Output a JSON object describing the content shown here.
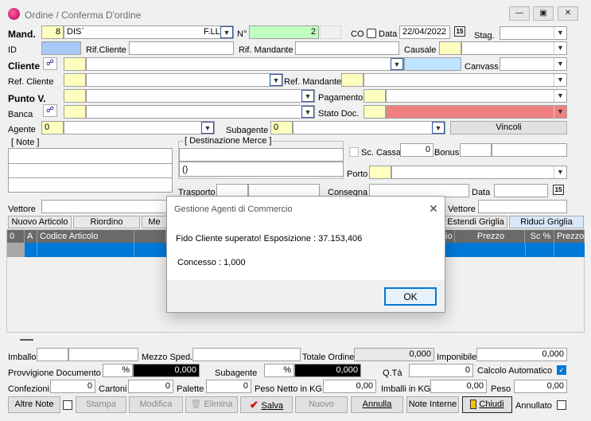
{
  "window": {
    "title": "Ordine / Conferma D'ordine"
  },
  "header": {
    "mand_label": "Mand.",
    "mand_code": "8",
    "mand_name": "DIS`",
    "mand_fl": "F.LL",
    "n_label": "N°",
    "n_value": "2",
    "co_label": "CO",
    "data_label": "Data",
    "data_value": "22/04/2022",
    "cal_label": "15",
    "stag_label": "Stag.",
    "id_label": "ID",
    "rif_cliente_label": "Rif.Cliente",
    "rif_mandante_label": "Rif. Mandante",
    "causale_label": "Causale",
    "cliente_label": "Cliente",
    "canvass_label": "Canvass",
    "ref_cliente_label": "Ref. Cliente",
    "ref_mandante_label": "Ref. Mandante",
    "punto_v_label": "Punto V.",
    "pagamento_label": "Pagamento",
    "banca_label": "Banca",
    "stato_doc_label": "Stato Doc.",
    "agente_label": "Agente",
    "agente_value": "0",
    "subagente_label": "Subagente",
    "subagente_value": "0",
    "vincoli_label": "Vincoli",
    "note_label": "[ Note ]",
    "dest_label": "[ Destinazione Merce  ]",
    "dest_value": "()",
    "sc_cassa_label": "Sc. Cassa",
    "sc_cassa_value": "0",
    "bonus_label": "Bonus",
    "porto_label": "Porto",
    "trasporto_label": "Trasporto",
    "consegna_label": "Consegna",
    "data2_label": "Data",
    "vettore_label": "Vettore",
    "vettore2_label": "Vettore"
  },
  "tabs": {
    "nuovo_articolo": "Nuovo Articolo",
    "riordino": "Riordino",
    "me": "Me",
    "estendi": "Estendi Griglia",
    "riduci": "Riduci Griglia"
  },
  "grid": {
    "headers": [
      "0",
      "A",
      "Codice Articolo",
      "io",
      "Prezzo",
      "Sc %",
      "Prezzo"
    ]
  },
  "footer": {
    "imballo_label": "Imballo",
    "mezzo_label": "Mezzo Sped.",
    "totale_label": "Totale Ordine",
    "totale_value": "0,000",
    "imponibile_label": "Imponibile",
    "imponibile_value": "0,000",
    "provv_label": "Provvigione Documento",
    "pct1": "%",
    "provv_value": "0,000",
    "subagente_label": "Subagente",
    "pct2": "%",
    "sub_value": "0,000",
    "qta_label": "Q.Tà",
    "qta_value": "0",
    "calcolo_label": "Calcolo Automatico",
    "confezioni_label": "Confezioni",
    "confezioni_value": "0",
    "cartoni_label": "Cartoni",
    "cartoni_value": "0",
    "palette_label": "Palette",
    "palette_value": "0",
    "peso_netto_label": "Peso Netto in KG",
    "peso_netto_value": "0,00",
    "imballi_label": "Imballi in KG",
    "imballi_value": "0,00",
    "peso_label": "Peso",
    "peso_value": "0,00"
  },
  "buttons": {
    "altre_note": "Altre Note",
    "stampa": "Stampa",
    "modifica": "Modifica",
    "elimina": "Elimina",
    "salva": "Salva",
    "nuovo": "Nuovo",
    "annulla": "Annulla",
    "note_interne": "Note Interne",
    "chiudi": "Chiudi",
    "annullato": "Annullato"
  },
  "dialog": {
    "title": "Gestione Agenti di Commercio",
    "line1": "Fido Cliente superato!  Esposizione : 37.153,406",
    "line2": "Concesso : 1,000",
    "ok": "OK"
  },
  "colors": {
    "accent": "#0078d7",
    "stato_doc": "#f08080",
    "grid_header": "#6a6a6a",
    "yellow_field": "#ffffc0",
    "green_field": "#c0ffc0"
  }
}
